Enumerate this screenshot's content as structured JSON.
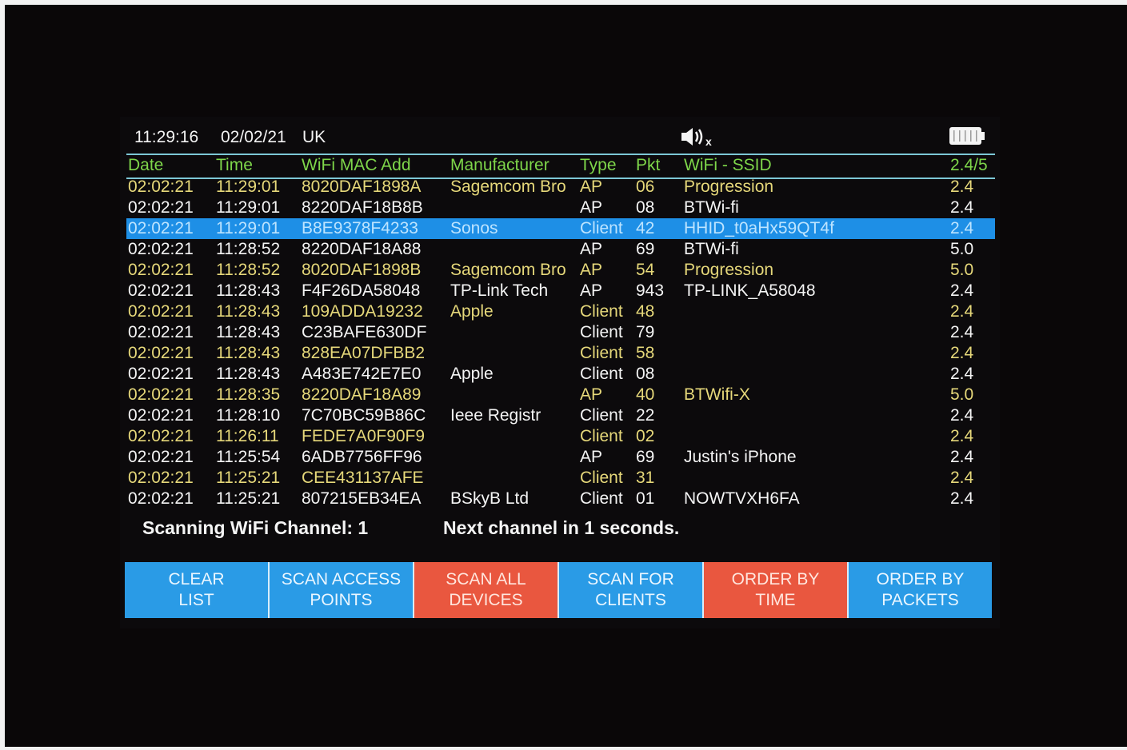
{
  "status": {
    "time": "11:29:16",
    "date": "02/02/21",
    "region": "UK",
    "sound_icon": "speaker-muted-icon",
    "battery_icon": "battery-icon"
  },
  "table": {
    "headers": {
      "date": "Date",
      "time": "Time",
      "mac": "WiFi MAC Add",
      "manufacturer": "Manufacturer",
      "type": "Type",
      "pkt": "Pkt",
      "ssid": "WiFi - SSID",
      "band": "2.4/5"
    },
    "rows": [
      {
        "date": "02:02:21",
        "time": "11:29:01",
        "mac": "8020DAF1898A",
        "manufacturer": "Sagemcom Bro",
        "type": "AP",
        "pkt": "06",
        "ssid": "Progression",
        "band": "2.4",
        "color": "yellow"
      },
      {
        "date": "02:02:21",
        "time": "11:29:01",
        "mac": "8220DAF18B8B",
        "manufacturer": "",
        "type": "AP",
        "pkt": "08",
        "ssid": "BTWi-fi",
        "band": "2.4",
        "color": "white"
      },
      {
        "date": "02:02:21",
        "time": "11:29:01",
        "mac": "B8E9378F4233",
        "manufacturer": "Sonos",
        "type": "Client",
        "pkt": "42",
        "ssid": "HHID_t0aHx59QT4f",
        "band": "2.4",
        "color": "selected"
      },
      {
        "date": "02:02:21",
        "time": "11:28:52",
        "mac": "8220DAF18A88",
        "manufacturer": "",
        "type": "AP",
        "pkt": "69",
        "ssid": "BTWi-fi",
        "band": "5.0",
        "color": "white"
      },
      {
        "date": "02:02:21",
        "time": "11:28:52",
        "mac": "8020DAF1898B",
        "manufacturer": "Sagemcom Bro",
        "type": "AP",
        "pkt": "54",
        "ssid": "Progression",
        "band": "5.0",
        "color": "yellow"
      },
      {
        "date": "02:02:21",
        "time": "11:28:43",
        "mac": "F4F26DA58048",
        "manufacturer": "TP-Link Tech",
        "type": "AP",
        "pkt": "943",
        "ssid": "TP-LINK_A58048",
        "band": "2.4",
        "color": "white"
      },
      {
        "date": "02:02:21",
        "time": "11:28:43",
        "mac": "109ADDA19232",
        "manufacturer": "Apple",
        "type": "Client",
        "pkt": "48",
        "ssid": "",
        "band": "2.4",
        "color": "yellow"
      },
      {
        "date": "02:02:21",
        "time": "11:28:43",
        "mac": "C23BAFE630DF",
        "manufacturer": "",
        "type": "Client",
        "pkt": "79",
        "ssid": "",
        "band": "2.4",
        "color": "white"
      },
      {
        "date": "02:02:21",
        "time": "11:28:43",
        "mac": "828EA07DFBB2",
        "manufacturer": "",
        "type": "Client",
        "pkt": "58",
        "ssid": "",
        "band": "2.4",
        "color": "yellow"
      },
      {
        "date": "02:02:21",
        "time": "11:28:43",
        "mac": "A483E742E7E0",
        "manufacturer": "Apple",
        "type": "Client",
        "pkt": "08",
        "ssid": "",
        "band": "2.4",
        "color": "white"
      },
      {
        "date": "02:02:21",
        "time": "11:28:35",
        "mac": "8220DAF18A89",
        "manufacturer": "",
        "type": "AP",
        "pkt": "40",
        "ssid": "BTWifi-X",
        "band": "5.0",
        "color": "yellow"
      },
      {
        "date": "02:02:21",
        "time": "11:28:10",
        "mac": "7C70BC59B86C",
        "manufacturer": "Ieee Registr",
        "type": "Client",
        "pkt": "22",
        "ssid": "",
        "band": "2.4",
        "color": "white"
      },
      {
        "date": "02:02:21",
        "time": "11:26:11",
        "mac": "FEDE7A0F90F9",
        "manufacturer": "",
        "type": "Client",
        "pkt": "02",
        "ssid": "",
        "band": "2.4",
        "color": "yellow"
      },
      {
        "date": "02:02:21",
        "time": "11:25:54",
        "mac": "6ADB7756FF96",
        "manufacturer": "",
        "type": "AP",
        "pkt": "69",
        "ssid": "Justin's iPhone",
        "band": "2.4",
        "color": "white"
      },
      {
        "date": "02:02:21",
        "time": "11:25:21",
        "mac": "CEE431137AFE",
        "manufacturer": "",
        "type": "Client",
        "pkt": "31",
        "ssid": "",
        "band": "2.4",
        "color": "yellow"
      },
      {
        "date": "02:02:21",
        "time": "11:25:21",
        "mac": "807215EB34EA",
        "manufacturer": "BSkyB Ltd",
        "type": "Client",
        "pkt": "01",
        "ssid": "NOWTVXH6FA",
        "band": "2.4",
        "color": "white"
      }
    ]
  },
  "footer": {
    "scanning_label": "Scanning WiFi Channel: 1",
    "next_channel_label": "Next channel in 1  seconds."
  },
  "buttons": [
    {
      "id": "clear-list",
      "line1": "CLEAR",
      "line2": "LIST",
      "color": "blue"
    },
    {
      "id": "scan-access-points",
      "line1": "SCAN ACCESS",
      "line2": "POINTS",
      "color": "blue"
    },
    {
      "id": "scan-all-devices",
      "line1": "SCAN ALL",
      "line2": "DEVICES",
      "color": "red"
    },
    {
      "id": "scan-for-clients",
      "line1": "SCAN FOR",
      "line2": "CLIENTS",
      "color": "blue"
    },
    {
      "id": "order-by-time",
      "line1": "ORDER BY",
      "line2": "TIME",
      "color": "red"
    },
    {
      "id": "order-by-packets",
      "line1": "ORDER BY",
      "line2": "PACKETS",
      "color": "blue"
    }
  ]
}
